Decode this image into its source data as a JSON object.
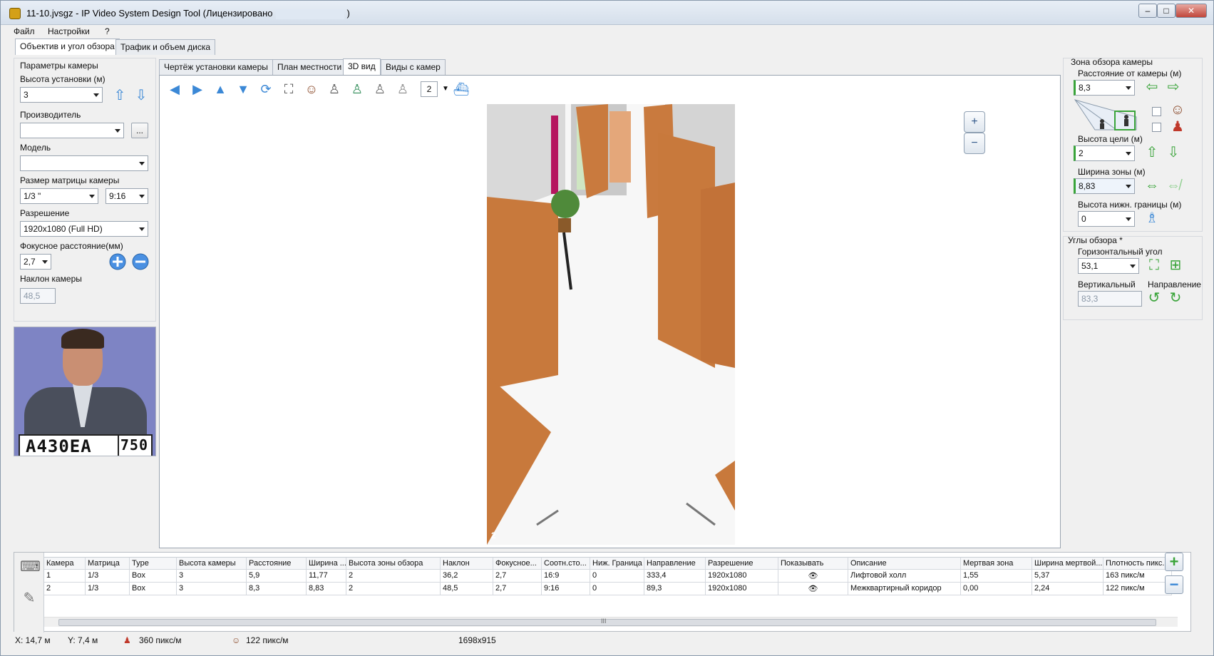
{
  "window": {
    "title_prefix": "11-10.jvsgz - IP Video System Design Tool (Лицензировано",
    "title_suffix": ")",
    "minimize": "–",
    "maximize": "□",
    "close": "✕"
  },
  "menu": [
    "Файл",
    "Настройки",
    "?"
  ],
  "top_tabs": [
    "Объектив и угол обзора",
    "Трафик и объем диска"
  ],
  "left": {
    "group_title": "Параметры камеры",
    "height_label": "Высота установки (м)",
    "height_value": "3",
    "vendor_label": "Производитель",
    "vendor_value": "",
    "vendor_button": "...",
    "model_label": "Модель",
    "model_value": "",
    "matrix_label": "Размер матрицы камеры",
    "matrix_value": "1/3 \"",
    "ratio_value": "9:16",
    "resolution_label": "Разрешение",
    "resolution_value": "1920x1080 (Full HD)",
    "focal_label": "Фокусное расстояние(мм)",
    "focal_value": "2,7",
    "tilt_label": "Наклон камеры",
    "tilt_value": "48,5",
    "plate_text": "A430EA",
    "plate_region": "750"
  },
  "sub_tabs": [
    "Чертёж установки камеры",
    "План местности",
    "3D вид",
    "Виды с камер"
  ],
  "toolbar": {
    "icons": [
      "arrow-left-icon",
      "arrow-right-icon",
      "arrow-up-icon",
      "arrow-down-icon",
      "rotate-icon",
      "fit-view-icon",
      "person-view-icon",
      "person-dark-icon",
      "person-green-icon",
      "person-grey-icon",
      "person-shadow-icon"
    ],
    "camera_number": "2"
  },
  "viewport": {
    "camera_label": "2",
    "zoom_in": "+",
    "zoom_out": "−"
  },
  "right": {
    "zone_title": "Зона обзора камеры",
    "distance_label": "Расстояние от камеры (м)",
    "distance_value": "8,3",
    "target_height_label": "Высота цели (м)",
    "target_height_value": "2",
    "zone_width_label": "Ширина зоны (м)",
    "zone_width_value": "8,83",
    "lower_bound_label": "Высота нижн. границы (м)",
    "lower_bound_value": "0",
    "angles_title": "Углы обзора *",
    "horizontal_label": "Горизонтальный угол",
    "horizontal_value": "53,1",
    "vertical_label": "Вертикальный",
    "vertical_value": "83,3",
    "direction_label": "Направление"
  },
  "table": {
    "columns": [
      "Камера",
      "Матрица",
      "Type",
      "Высота камеры",
      "Расстояние",
      "Ширина ...",
      "Высота зоны обзора",
      "Наклон",
      "Фокусное...",
      "Соотн.сто...",
      "Ниж. Граница",
      "Направление",
      "Разрешение",
      "Показывать",
      "Описание",
      "Мертвая зона",
      "Ширина мертвой...",
      "Плотность пикс..."
    ],
    "rows": [
      [
        "1",
        "1/3",
        "Box",
        "3",
        "5,9",
        "11,77",
        "2",
        "36,2",
        "2,7",
        "16:9",
        "0",
        "333,4",
        "1920x1080",
        "👁",
        "Лифтовой холл",
        "1,55",
        "5,37",
        "163 пикс/м"
      ],
      [
        "2",
        "1/3",
        "Box",
        "3",
        "8,3",
        "8,83",
        "2",
        "48,5",
        "2,7",
        "9:16",
        "0",
        "89,3",
        "1920x1080",
        "👁",
        "Межквартирный коридор",
        "0,00",
        "2,24",
        "122 пикс/м"
      ]
    ],
    "scroll_marker": "III"
  },
  "status": {
    "x": "X: 14,7 м",
    "y": "Y: 7,4 м",
    "density_face": "360 пикс/м",
    "density_body": "122 пикс/м",
    "size": "1698x915"
  }
}
